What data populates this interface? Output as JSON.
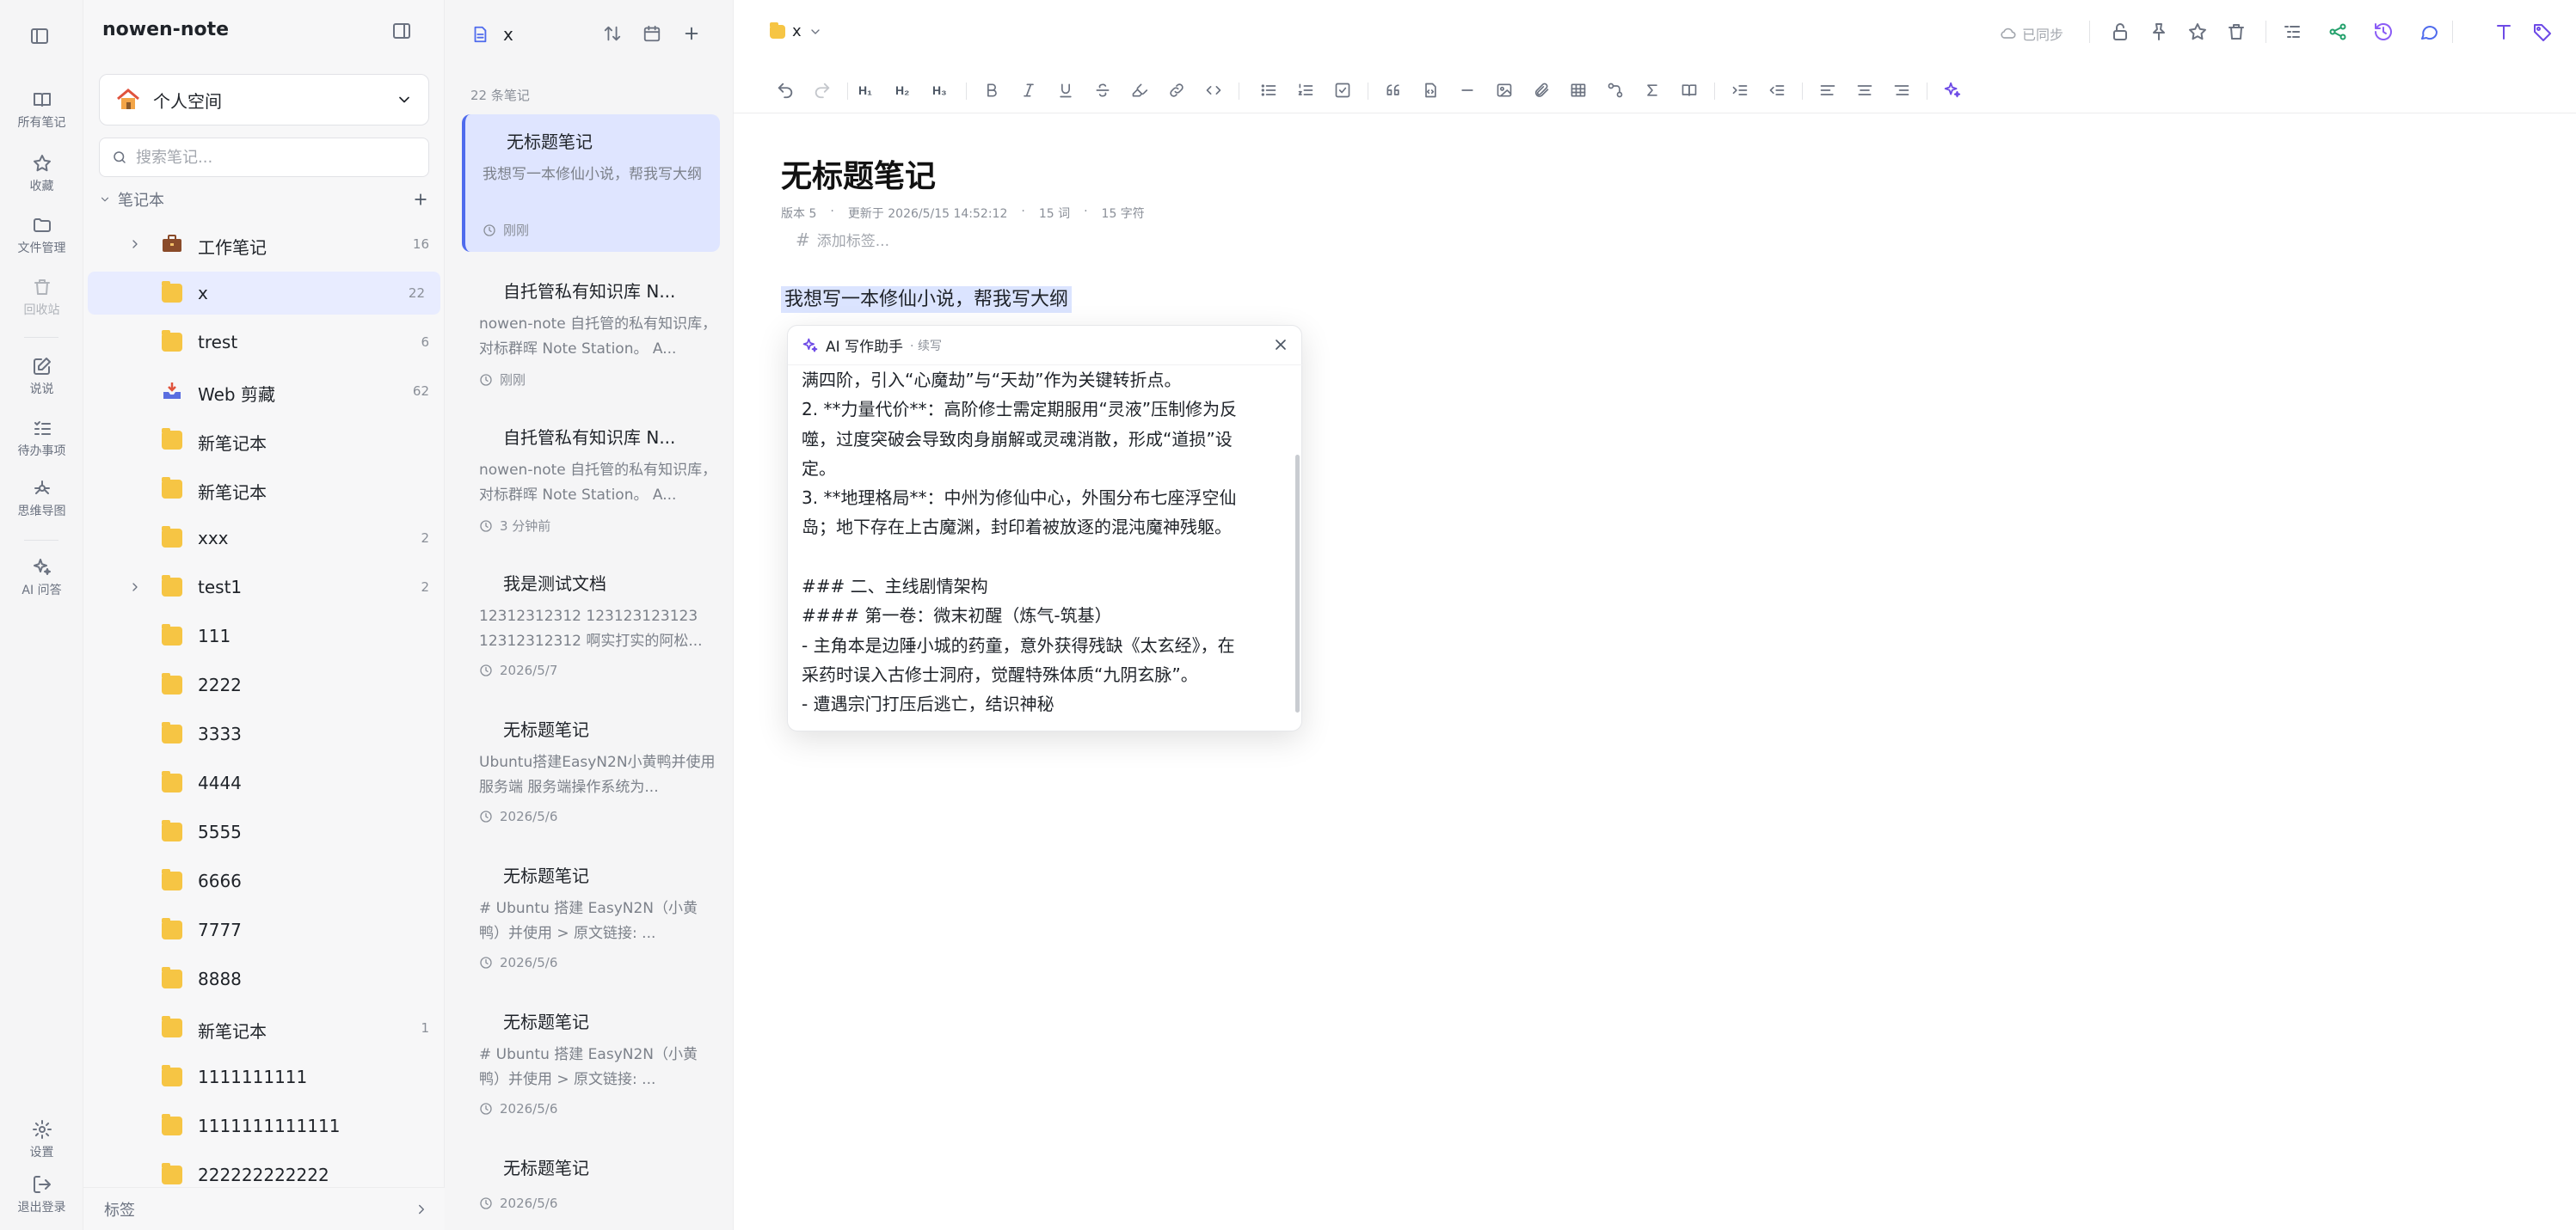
{
  "rail": {
    "items": [
      {
        "label": "所有笔记",
        "icon": "book-icon"
      },
      {
        "label": "收藏",
        "icon": "star-icon"
      },
      {
        "label": "文件管理",
        "icon": "folder-icon"
      },
      {
        "label": "回收站",
        "icon": "trash-icon"
      },
      {
        "label": "说说",
        "icon": "edit-icon"
      },
      {
        "label": "待办事项",
        "icon": "todo-icon"
      },
      {
        "label": "思维导图",
        "icon": "mindmap-icon"
      },
      {
        "label": "AI 问答",
        "icon": "sparkle-icon"
      },
      {
        "label": "设置",
        "icon": "gear-icon"
      },
      {
        "label": "退出登录",
        "icon": "logout-icon"
      }
    ]
  },
  "sidebar": {
    "app_title": "nowen-note",
    "space_name": "个人空间",
    "search_placeholder": "搜索笔记...",
    "notebooks_header": "笔记本",
    "tags_footer": "标签",
    "notebooks": [
      {
        "name": "工作笔记",
        "count": "16",
        "icon": "briefcase-icon",
        "expandable": true
      },
      {
        "name": "x",
        "count": "22",
        "icon": "notebook-icon",
        "active": true
      },
      {
        "name": "trest",
        "count": "6",
        "icon": "notebook-icon"
      },
      {
        "name": "Web 剪藏",
        "count": "62",
        "icon": "inbox-tray-icon"
      },
      {
        "name": "新笔记本",
        "count": "",
        "icon": "notebook-icon"
      },
      {
        "name": "新笔记本",
        "count": "",
        "icon": "notebook-icon"
      },
      {
        "name": "xxx",
        "count": "2",
        "icon": "notebook-icon"
      },
      {
        "name": "test1",
        "count": "2",
        "icon": "notebook-icon",
        "expandable": true
      },
      {
        "name": "111",
        "count": "",
        "icon": "notebook-icon"
      },
      {
        "name": "2222",
        "count": "",
        "icon": "notebook-icon"
      },
      {
        "name": "3333",
        "count": "",
        "icon": "notebook-icon"
      },
      {
        "name": "4444",
        "count": "",
        "icon": "notebook-icon"
      },
      {
        "name": "5555",
        "count": "",
        "icon": "notebook-icon"
      },
      {
        "name": "6666",
        "count": "",
        "icon": "notebook-icon"
      },
      {
        "name": "7777",
        "count": "",
        "icon": "notebook-icon"
      },
      {
        "name": "8888",
        "count": "",
        "icon": "notebook-icon"
      },
      {
        "name": "新笔记本",
        "count": "1",
        "icon": "notebook-icon"
      },
      {
        "name": "1111111111",
        "count": "",
        "icon": "notebook-icon"
      },
      {
        "name": "1111111111111",
        "count": "",
        "icon": "notebook-icon"
      },
      {
        "name": "222222222222",
        "count": "",
        "icon": "notebook-icon"
      }
    ]
  },
  "notelist": {
    "title": "x",
    "count_text": "22 条笔记",
    "notes": [
      {
        "title": "无标题笔记",
        "excerpt": "我想写一本修仙小说，帮我写大纲",
        "time": "刚刚",
        "active": true
      },
      {
        "title": "自托管私有知识库 N...",
        "excerpt": "nowen-note 自托管的私有知识库，对标群晖 Note Station。 A...",
        "time": "刚刚"
      },
      {
        "title": "自托管私有知识库 N...",
        "excerpt": "nowen-note 自托管的私有知识库，对标群晖 Note Station。 A...",
        "time": "3 分钟前"
      },
      {
        "title": "我是测试文档",
        "excerpt": "12312312312 123123123123 12312312312 啊实打实的阿松...",
        "time": "2026/5/7"
      },
      {
        "title": "无标题笔记",
        "excerpt": "Ubuntu搭建EasyN2N小黄鸭并使用 服务端 服务端操作系统为...",
        "time": "2026/5/6"
      },
      {
        "title": "无标题笔记",
        "excerpt": "# Ubuntu 搭建 EasyN2N（小黄鸭）并使用 > 原文链接: ...",
        "time": "2026/5/6"
      },
      {
        "title": "无标题笔记",
        "excerpt": "# Ubuntu 搭建 EasyN2N（小黄鸭）并使用 > 原文链接: ...",
        "time": "2026/5/6"
      },
      {
        "title": "无标题笔记",
        "excerpt": "",
        "time": "2026/5/6"
      }
    ]
  },
  "editor": {
    "breadcrumb": "x",
    "sync_status": "已同步",
    "title": "无标题笔记",
    "meta": {
      "version": "版本 5",
      "updated": "更新于 2026/5/15 14:52:12",
      "words": "15 词",
      "chars": "15 字符"
    },
    "add_tag": "添加标签...",
    "body_text": "我想写一本修仙小说，帮我写大纲"
  },
  "ai_assistant": {
    "title": "AI 写作助手",
    "subtitle": "· 续写",
    "lines": [
      "满四阶，引入“心魔劫”与“天劫”作为关键转折点。",
      "2. **力量代价**：高阶修士需定期服用“灵液”压制修为反",
      "噬，过度突破会导致肉身崩解或灵魂消散，形成“道损”设",
      "定。",
      "3. **地理格局**：中州为修仙中心，外围分布七座浮空仙",
      "岛；地下存在上古魔渊，封印着被放逐的混沌魔神残躯。",
      "",
      "### 二、主线剧情架构",
      "#### 第一卷：微末初醒（炼气-筑基）",
      "- 主角本是边陲小城的药童，意外获得残缺《太玄经》，在",
      "采药时误入古修士洞府，觉醒特殊体质“九阴玄脉”。",
      "- 遭遇宗门打压后逃亡，结识神秘"
    ]
  },
  "colors": {
    "accent": "#4f6bed",
    "selection": "#dbe4ff",
    "folder": "#f6c544",
    "share": "#22a06b",
    "history": "#8b5cf6",
    "tag": "#6d4ae6"
  }
}
